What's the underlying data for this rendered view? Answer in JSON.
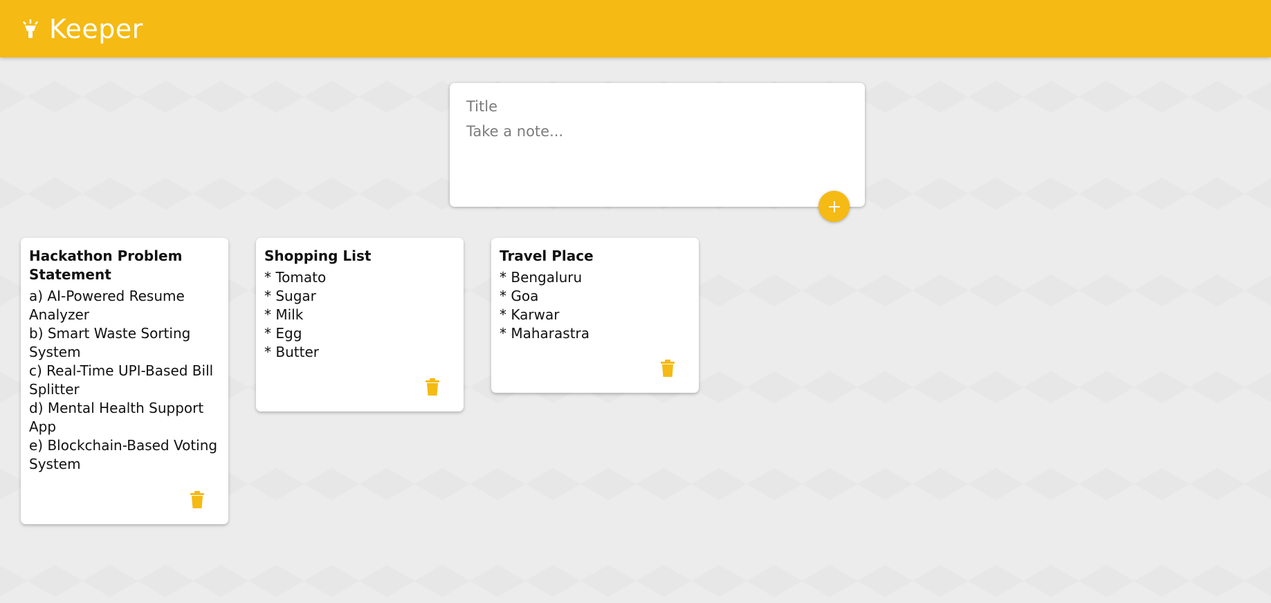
{
  "app": {
    "title": "Keeper",
    "logo_icon": "highlight-lamp-icon",
    "accent": "#f5ba13"
  },
  "composer": {
    "title_placeholder": "Title",
    "content_placeholder": "Take a note...",
    "add_icon": "plus-icon"
  },
  "notes": [
    {
      "title": "Hackathon Problem Statement",
      "content": "a) AI-Powered Resume Analyzer\nb) Smart Waste Sorting System\nc) Real-Time UPI-Based Bill Splitter\nd) Mental Health Support App\ne) Blockchain-Based Voting System",
      "delete_icon": "trash-icon"
    },
    {
      "title": "Shopping List",
      "content": "* Tomato\n* Sugar\n* Milk\n* Egg\n* Butter",
      "delete_icon": "trash-icon"
    },
    {
      "title": "Travel Place",
      "content": "* Bengaluru\n* Goa\n* Karwar\n* Maharastra",
      "delete_icon": "trash-icon"
    }
  ]
}
